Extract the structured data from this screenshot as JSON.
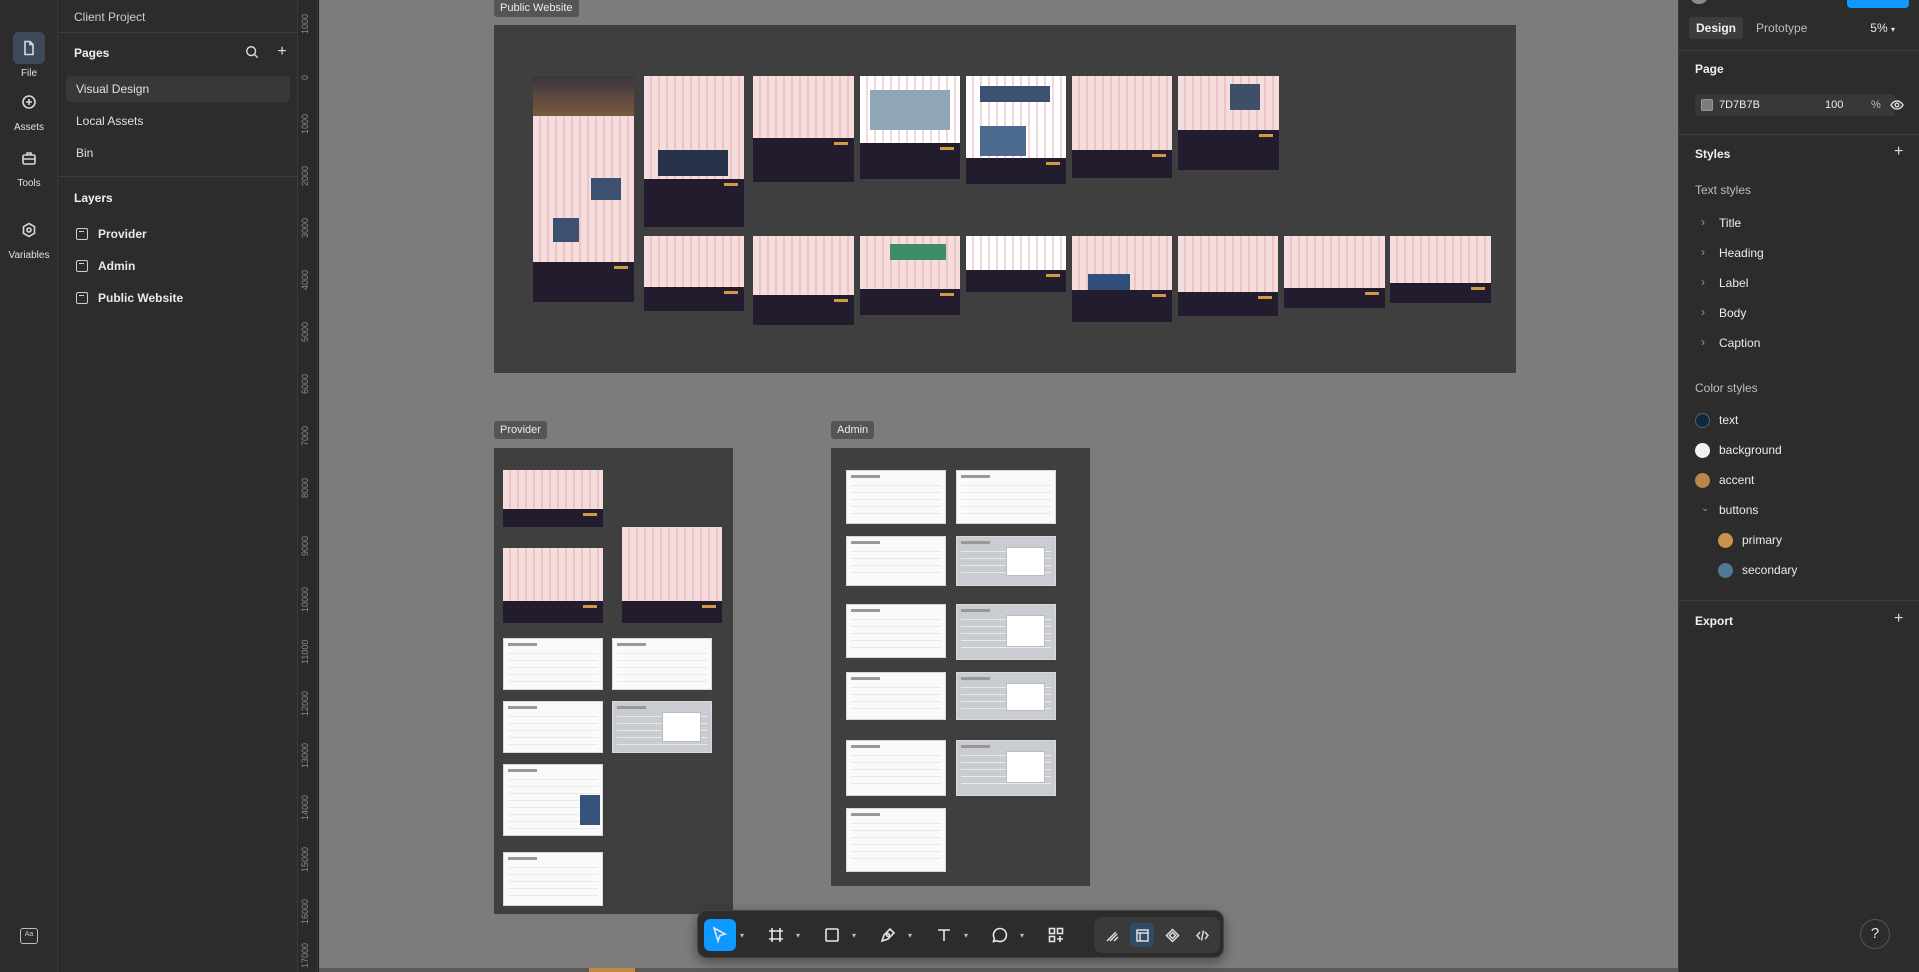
{
  "rail": {
    "items": [
      {
        "label": "File",
        "icon": "file-icon"
      },
      {
        "label": "Assets",
        "icon": "assets-icon"
      },
      {
        "label": "Tools",
        "icon": "tools-icon"
      },
      {
        "label": "Variables",
        "icon": "variables-icon"
      }
    ],
    "bottom_icon": "Aa"
  },
  "left": {
    "project": "Client Project",
    "pages_title": "Pages",
    "pages": [
      "Visual Design",
      "Local Assets",
      "Bin"
    ],
    "layers_title": "Layers",
    "layers": [
      "Provider",
      "Admin",
      "Public Website"
    ]
  },
  "ruler": {
    "labels": [
      "1000",
      "0",
      "1000",
      "2000",
      "3000",
      "4000",
      "5000",
      "6000",
      "7000",
      "8000",
      "9000",
      "10000",
      "11000",
      "12000",
      "13000",
      "14000",
      "15000",
      "16000",
      "17000"
    ]
  },
  "canvas": {
    "background": "#7D7B7B",
    "frames": {
      "public": "Public Website",
      "provider": "Provider",
      "admin": "Admin"
    }
  },
  "toolbar": {
    "tools": [
      "move-tool",
      "frame-tool",
      "rectangle-tool",
      "pen-tool",
      "text-tool",
      "comment-tool",
      "actions-tool"
    ],
    "modes": [
      "draw-mode",
      "design-mode",
      "dev-component-mode",
      "dev-mode"
    ]
  },
  "right": {
    "tabs": [
      "Design",
      "Prototype"
    ],
    "zoom": "5%",
    "page_title": "Page",
    "page_color": "7D7B7B",
    "page_opacity": "100",
    "page_opacity_unit": "%",
    "styles_title": "Styles",
    "text_styles_title": "Text styles",
    "text_styles": [
      "Title",
      "Heading",
      "Label",
      "Body",
      "Caption"
    ],
    "color_styles_title": "Color styles",
    "color_styles": [
      {
        "name": "text",
        "color": "#0F2A40"
      },
      {
        "name": "background",
        "color": "#F2F2F2"
      },
      {
        "name": "accent",
        "color": "#B9864A"
      }
    ],
    "buttons_group": "buttons",
    "button_colors": [
      {
        "name": "primary",
        "color": "#C8924A"
      },
      {
        "name": "secondary",
        "color": "#4E7B93"
      }
    ],
    "export_title": "Export"
  },
  "help": "?"
}
